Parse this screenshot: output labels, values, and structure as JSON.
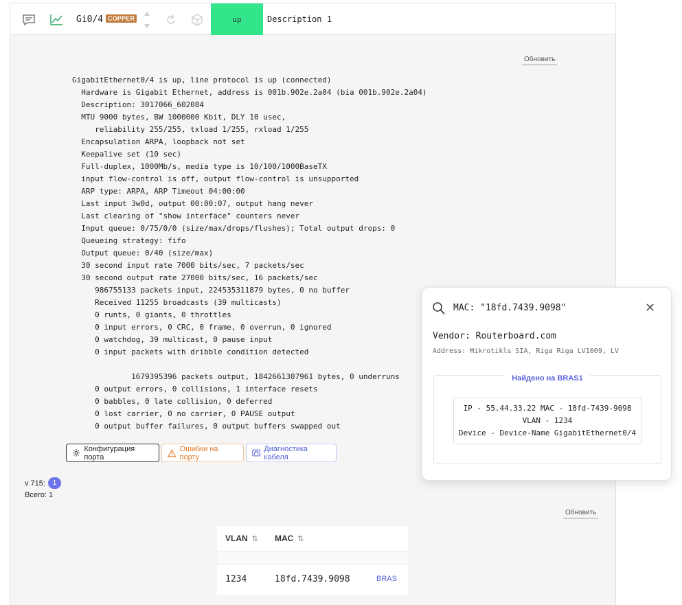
{
  "toolbar": {
    "interface_name": "Gi0/4",
    "media_badge": "COPPER",
    "status": "up",
    "description": "Description 1",
    "colors": {
      "status_up": "#32e58a",
      "copper_badge": "#c07a3a"
    }
  },
  "interface_panel": {
    "refresh_label": "Обновить",
    "output_lines": [
      "GigabitEthernet0/4 is up, line protocol is up (connected)",
      "  Hardware is Gigabit Ethernet, address is 001b.902e.2a04 (bia 001b.902e.2a04)",
      "  Description: 3017066_602084",
      "  MTU 9000 bytes, BW 1000000 Kbit, DLY 10 usec,",
      "     reliability 255/255, txload 1/255, rxload 1/255",
      "  Encapsulation ARPA, loopback not set",
      "  Keepalive set (10 sec)",
      "  Full-duplex, 1000Mb/s, media type is 10/100/1000BaseTX",
      "  input flow-control is off, output flow-control is unsupported",
      "  ARP type: ARPA, ARP Timeout 04:00:00",
      "  Last input 3w0d, output 00:00:07, output hang never",
      "  Last clearing of \"show interface\" counters never",
      "  Input queue: 0/75/0/0 (size/max/drops/flushes); Total output drops: 0",
      "  Queueing strategy: fifo",
      "  Output queue: 0/40 (size/max)",
      "  30 second input rate 7000 bits/sec, 7 packets/sec",
      "  30 second output rate 27000 bits/sec, 16 packets/sec",
      "     986755133 packets input, 224535311879 bytes, 0 no buffer",
      "     Received 11255 broadcasts (39 multicasts)",
      "     0 runts, 0 giants, 0 throttles",
      "     0 input errors, 0 CRC, 0 frame, 0 overrun, 0 ignored",
      "     0 watchdog, 39 multicast, 0 pause input",
      "     0 input packets with dribble condition detected",
      "",
      "             1679395396 packets output, 1842661307961 bytes, 0 underruns",
      "     0 output errors, 0 collisions, 1 interface resets",
      "     0 babbles, 0 late collision, 0 deferred",
      "     0 lost carrier, 0 no carrier, 0 PAUSE output",
      "     0 output buffer failures, 0 output buffers swapped out"
    ],
    "buttons": {
      "config": "Конфигурация порта",
      "errors": "Ошибки на порту",
      "diagnostics": "Диагностика кабеля"
    }
  },
  "mac_section": {
    "vlan_label": "v 715:",
    "vlan_count": "1",
    "total_label": "Всего: 1",
    "refresh_label": "Обновить",
    "table": {
      "headers": [
        "VLAN",
        "MAC"
      ],
      "rows": [
        {
          "vlan": "1234",
          "mac": "18fd.7439.9098",
          "link": "BRAS"
        }
      ]
    }
  },
  "popup": {
    "title": "MAC: \"18fd.7439.9098\"",
    "vendor": "Vendor: Routerboard.com",
    "address": "Address: Mikrotikls SIA, Riga Riga LV1009, LV",
    "found_title": "Найдено на BRAS1",
    "found_lines": [
      "IP - 55.44.33.22 MAC - 18fd-7439-9098",
      "VLAN - 1234",
      "Device - Device-Name GigabitEthernet0/4"
    ]
  }
}
